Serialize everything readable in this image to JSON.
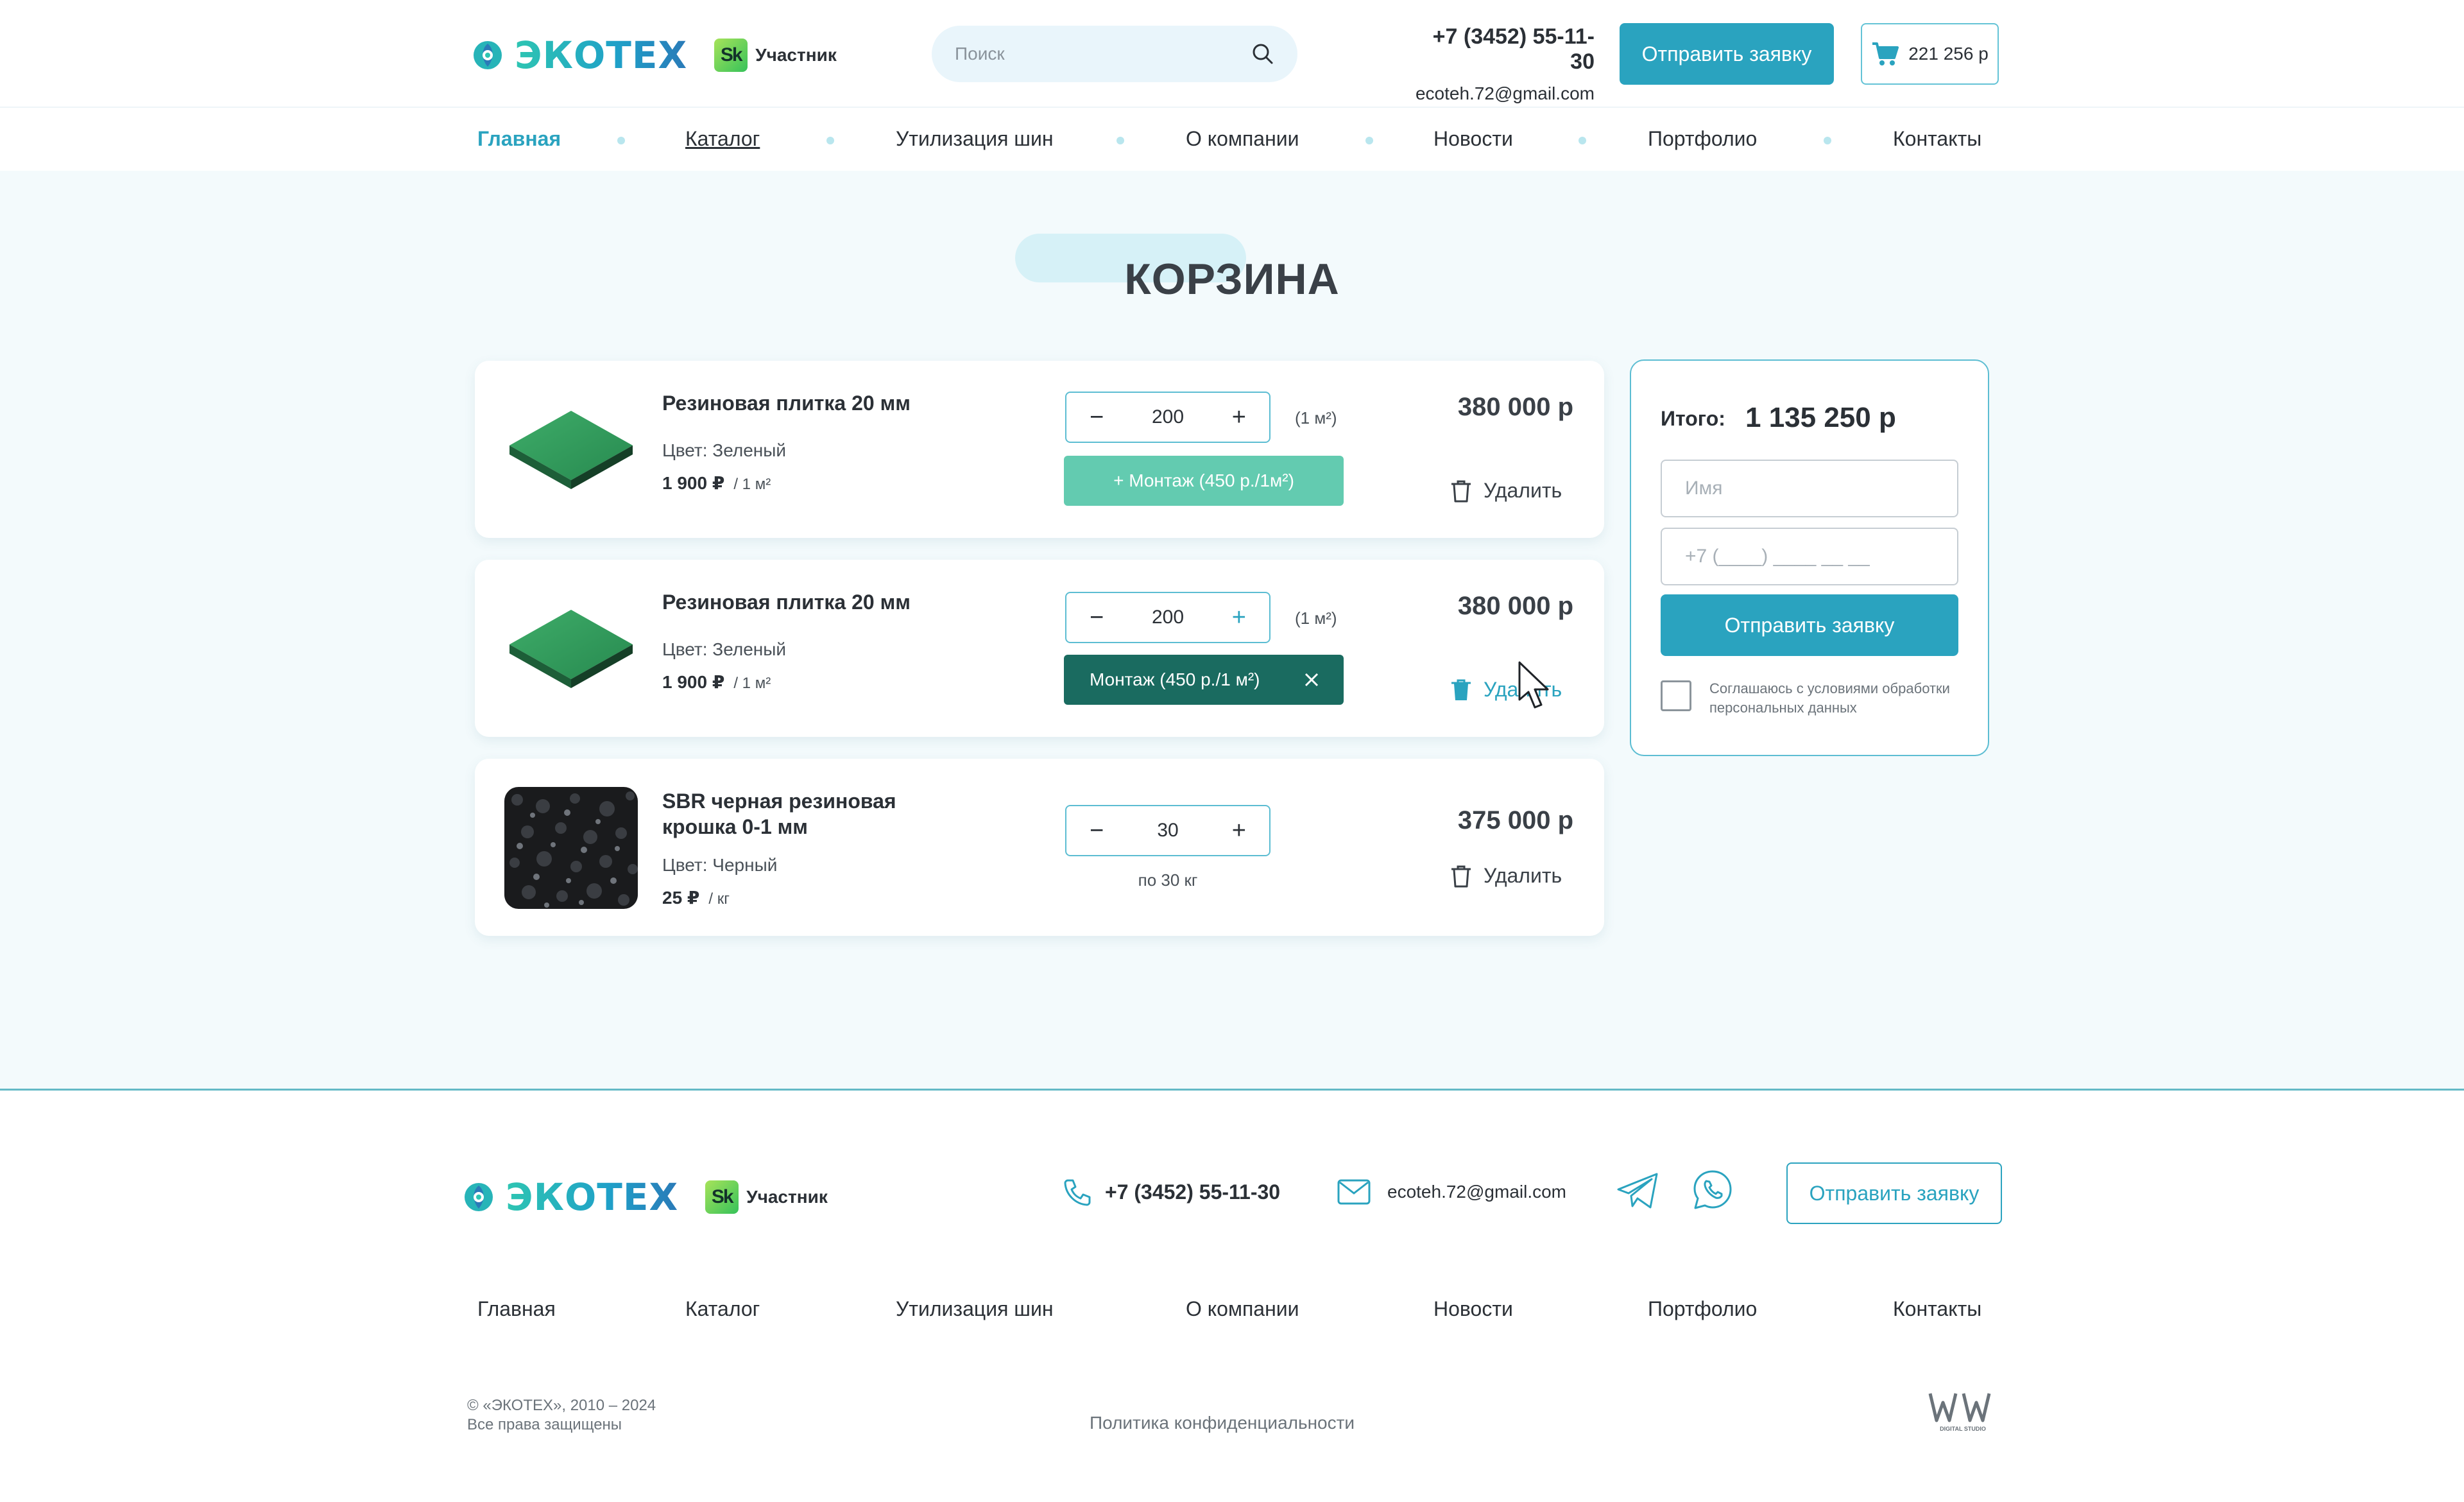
{
  "header": {
    "logo_text": "ЭКОТЕХ",
    "sk_badge": "Sk",
    "sk_label": "Участник",
    "search_placeholder": "Поиск",
    "phone": "+7 (3452) 55-11-30",
    "email": "ecoteh.72@gmail.com",
    "request_button": "Отправить заявку",
    "cart_total": "221 256 р"
  },
  "nav": {
    "items": [
      {
        "label": "Главная",
        "active": true
      },
      {
        "label": "Каталог"
      },
      {
        "label": "Утилизация шин"
      },
      {
        "label": "О компании"
      },
      {
        "label": "Новости"
      },
      {
        "label": "Портфолио"
      },
      {
        "label": "Контакты"
      }
    ]
  },
  "page": {
    "title": "КОРЗИНА"
  },
  "cart": {
    "items": [
      {
        "name": "Резиновая плитка 20 мм",
        "color_text": "Цвет: Зеленый",
        "price": "1 900 ₽",
        "price_unit": "/ 1 м²",
        "qty": "200",
        "qty_unit": "(1 м²)",
        "mount_label": "+ Монтаж (450 р./1м²)",
        "mount_selected": false,
        "total": "380 000 р",
        "delete_label": "Удалить"
      },
      {
        "name": "Резиновая плитка 20 мм",
        "color_text": "Цвет: Зеленый",
        "price": "1 900 ₽",
        "price_unit": "/ 1 м²",
        "qty": "200",
        "qty_unit": "(1 м²)",
        "mount_label": "Монтаж (450 р./1 м²)",
        "mount_selected": true,
        "total": "380 000 р",
        "delete_label": "Удалить"
      },
      {
        "name": "SBR черная резиновая крошка 0-1 мм",
        "color_text": "Цвет: Черный",
        "price": "25 ₽",
        "price_unit": "/ кг",
        "qty": "30",
        "qty_note": "по 30 кг",
        "total": "375 000 р",
        "delete_label": "Удалить"
      }
    ],
    "qty_minus": "−",
    "qty_plus": "+"
  },
  "summary": {
    "total_label": "Итого:",
    "total_value": "1 135 250 р",
    "name_placeholder": "Имя",
    "phone_placeholder": "+7 (____) ____ __ __",
    "submit_label": "Отправить заявку",
    "consent_text": "Соглашаюсь с условиями обработки персональных данных",
    "consent_checked": false
  },
  "footer": {
    "logo_text": "ЭКОТЕХ",
    "sk_badge": "Sk",
    "sk_label": "Участник",
    "phone": "+7 (3452) 55-11-30",
    "email": "ecoteh.72@gmail.com",
    "request_button": "Отправить заявку",
    "nav": [
      "Главная",
      "Каталог",
      "Утилизация шин",
      "О компании",
      "Новости",
      "Портфолио",
      "Контакты"
    ],
    "copyright_line1": "© «ЭКОТЕХ», 2010 – 2024",
    "copyright_line2": "Все права защищены",
    "policy": "Политика конфиденциальности",
    "studio_caption": "DIGITAL STUDIO"
  },
  "colors": {
    "accent": "#2aa3bf",
    "mount_idle": "#63cbb0",
    "mount_active": "#1a6b60",
    "background": "#f3fafc"
  },
  "icons": [
    "logo-leaf-icon",
    "search-icon",
    "cart-icon",
    "trash-icon",
    "close-icon",
    "phone-icon",
    "mail-icon",
    "telegram-icon",
    "whatsapp-icon",
    "cursor-icon"
  ]
}
